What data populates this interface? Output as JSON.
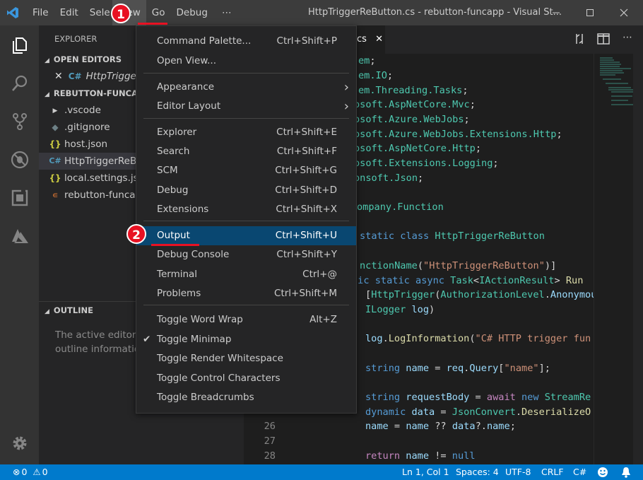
{
  "titlebar": {
    "menus": [
      "File",
      "Edit",
      "Sele",
      "View",
      "Go",
      "Debug",
      "⋯"
    ],
    "title": "HttpTriggerReButton.cs - rebutton-funcapp - Visual St..."
  },
  "explorer": {
    "title": "EXPLORER",
    "open_editors": "OPEN EDITORS",
    "open_file": "HttpTriggerR",
    "project": "REBUTTON-FUNCAP",
    "files": [
      {
        "label": ".vscode",
        "icon": "chevron-right"
      },
      {
        "label": ".gitignore",
        "icon": "diamond"
      },
      {
        "label": "host.json",
        "icon": "braces"
      },
      {
        "label": "HttpTriggerReBu",
        "icon": "csharp"
      },
      {
        "label": "local.settings.jsc",
        "icon": "braces"
      },
      {
        "label": "rebutton-funcap",
        "icon": "rss"
      }
    ],
    "outline_title": "OUTLINE",
    "outline_text1": "The active editor c",
    "outline_text2": "outline informatio"
  },
  "editor": {
    "tab_label": "cs",
    "line_numbers": [
      "26",
      "27",
      "28"
    ]
  },
  "menu": {
    "items": [
      {
        "label": "Command Palette...",
        "shortcut": "Ctrl+Shift+P"
      },
      {
        "label": "Open View...",
        "shortcut": ""
      },
      {
        "label": "Appearance",
        "shortcut": "",
        "submenu": true
      },
      {
        "label": "Editor Layout",
        "shortcut": "",
        "submenu": true
      },
      {
        "label": "Explorer",
        "shortcut": "Ctrl+Shift+E"
      },
      {
        "label": "Search",
        "shortcut": "Ctrl+Shift+F"
      },
      {
        "label": "SCM",
        "shortcut": "Ctrl+Shift+G"
      },
      {
        "label": "Debug",
        "shortcut": "Ctrl+Shift+D"
      },
      {
        "label": "Extensions",
        "shortcut": "Ctrl+Shift+X"
      },
      {
        "label": "Output",
        "shortcut": "Ctrl+Shift+U"
      },
      {
        "label": "Debug Console",
        "shortcut": "Ctrl+Shift+Y"
      },
      {
        "label": "Terminal",
        "shortcut": "Ctrl+@"
      },
      {
        "label": "Problems",
        "shortcut": "Ctrl+Shift+M"
      },
      {
        "label": "Toggle Word Wrap",
        "shortcut": "Alt+Z"
      },
      {
        "label": "Toggle Minimap",
        "shortcut": "",
        "checked": true
      },
      {
        "label": "Toggle Render Whitespace",
        "shortcut": ""
      },
      {
        "label": "Toggle Control Characters",
        "shortcut": ""
      },
      {
        "label": "Toggle Breadcrumbs",
        "shortcut": ""
      }
    ]
  },
  "annotations": {
    "step1": "1",
    "step2": "2"
  },
  "status": {
    "errors": "0",
    "warnings": "0",
    "position": "Ln 1, Col 1",
    "spaces": "Spaces: 4",
    "encoding": "UTF-8",
    "eol": "CRLF",
    "language": "C#"
  },
  "colors": {
    "accent": "#007acc",
    "highlight": "#094771",
    "annotation": "#e81123"
  }
}
